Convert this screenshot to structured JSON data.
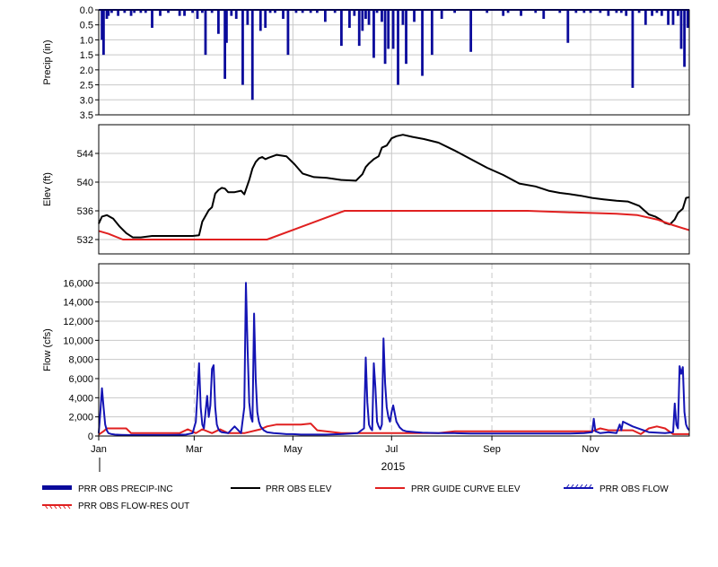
{
  "colors": {
    "precip": "#0a0a9b",
    "obs_elev": "#000000",
    "guide_curve": "#e02020",
    "obs_flow": "#1414b4",
    "res_out": "#e02020",
    "grid": "#c8c8c8",
    "frame": "#000000"
  },
  "chart_data": [
    {
      "type": "bar",
      "ylabel": "Precip (in)",
      "ylim": [
        0,
        3.5
      ],
      "y_inverted": true,
      "yticks": [
        "0.0",
        "0.5",
        "1.0",
        "1.5",
        "2.0",
        "2.5",
        "3.0",
        "3.5"
      ],
      "x_unit": "day of year 2015",
      "series": [
        {
          "name": "PRR OBS PRECIP-INC",
          "x": [
            2,
            3,
            5,
            6,
            8,
            12,
            16,
            20,
            22,
            26,
            29,
            33,
            38,
            43,
            50,
            53,
            58,
            61,
            64,
            66,
            70,
            74,
            78,
            79,
            82,
            85,
            89,
            92,
            95,
            100,
            103,
            106,
            109,
            114,
            117,
            122,
            126,
            131,
            135,
            140,
            146,
            150,
            155,
            158,
            161,
            163,
            165,
            167,
            170,
            172,
            175,
            177,
            179,
            182,
            185,
            188,
            190,
            195,
            200,
            206,
            212,
            220,
            230,
            240,
            250,
            253,
            261,
            270,
            275,
            285,
            290,
            295,
            300,
            304,
            310,
            315,
            320,
            323,
            326,
            330,
            334,
            338,
            342,
            345,
            348,
            352,
            355,
            358,
            360,
            362,
            364
          ],
          "values": [
            1.0,
            1.5,
            0.3,
            0.2,
            0.1,
            0.2,
            0.1,
            0.2,
            0.1,
            0.1,
            0.1,
            0.6,
            0.2,
            0.1,
            0.2,
            0.2,
            0.1,
            0.3,
            0.1,
            1.5,
            0.1,
            0.8,
            2.3,
            1.1,
            0.2,
            0.3,
            2.5,
            0.5,
            3.0,
            0.7,
            0.6,
            0.1,
            0.1,
            0.3,
            1.5,
            0.1,
            0.1,
            0.1,
            0.1,
            0.4,
            0.1,
            1.2,
            0.6,
            0.2,
            1.2,
            0.7,
            0.3,
            0.5,
            1.6,
            0.1,
            0.4,
            1.8,
            1.3,
            1.3,
            2.5,
            0.5,
            1.8,
            0.4,
            2.2,
            1.5,
            0.3,
            0.1,
            1.4,
            0.1,
            0.2,
            0.1,
            0.2,
            0.1,
            0.3,
            0.1,
            1.1,
            0.1,
            0.1,
            0.1,
            0.1,
            0.2,
            0.1,
            0.1,
            0.2,
            2.6,
            0.1,
            0.5,
            0.2,
            0.1,
            0.2,
            0.5,
            0.5,
            0.2,
            1.3,
            1.9,
            0.6
          ]
        }
      ]
    },
    {
      "type": "line",
      "ylabel": "Elev (ft)",
      "ylim": [
        530,
        548
      ],
      "yticks": [
        "532",
        "536",
        "540",
        "544"
      ],
      "x_unit": "day of year 2015",
      "series": [
        {
          "name": "PRR OBS ELEV",
          "x": [
            0,
            2,
            5,
            9,
            13,
            17,
            21,
            26,
            33,
            40,
            46,
            52,
            58,
            62,
            64,
            66,
            68,
            70,
            72,
            74,
            76,
            78,
            80,
            84,
            88,
            90,
            93,
            95,
            97,
            99,
            101,
            103,
            105,
            110,
            116,
            121,
            126,
            133,
            141,
            150,
            159,
            163,
            165,
            167,
            170,
            173,
            175,
            178,
            181,
            184,
            188,
            194,
            201,
            210,
            220,
            230,
            240,
            250,
            260,
            270,
            278,
            285,
            292,
            298,
            305,
            312,
            320,
            327,
            334,
            340,
            344,
            347,
            350,
            353,
            356,
            358,
            361,
            363,
            365
          ],
          "values": [
            534.2,
            535.2,
            535.4,
            534.9,
            533.8,
            532.9,
            532.3,
            532.3,
            532.5,
            532.5,
            532.5,
            532.5,
            532.5,
            532.6,
            534.5,
            535.3,
            536.1,
            536.5,
            538.4,
            538.9,
            539.2,
            539.1,
            538.6,
            538.6,
            538.8,
            538.3,
            540.3,
            541.9,
            542.8,
            543.3,
            543.5,
            543.2,
            543.4,
            543.8,
            543.6,
            542.5,
            541.2,
            540.7,
            540.6,
            540.3,
            540.2,
            541.1,
            542.1,
            542.6,
            543.2,
            543.6,
            544.8,
            545.1,
            546.1,
            546.4,
            546.6,
            546.3,
            546.0,
            545.5,
            544.4,
            543.2,
            542.0,
            541.0,
            539.8,
            539.4,
            538.8,
            538.5,
            538.3,
            538.1,
            537.8,
            537.6,
            537.4,
            537.3,
            536.7,
            535.5,
            535.2,
            534.8,
            534.3,
            534.1,
            534.8,
            535.7,
            536.3,
            537.8,
            537.9
          ]
        },
        {
          "name": "PRR GUIDE CURVE ELEV",
          "x": [
            0,
            6,
            15,
            104,
            152,
            181,
            249,
            265,
            290,
            320,
            333,
            345,
            355,
            365
          ],
          "values": [
            533.2,
            532.8,
            532.0,
            532.0,
            536.0,
            536.0,
            536.0,
            536.0,
            535.8,
            535.6,
            535.4,
            534.8,
            534.0,
            533.3
          ]
        }
      ]
    },
    {
      "type": "line",
      "ylabel": "Flow (cfs)",
      "ylim": [
        0,
        18000
      ],
      "yticks": [
        "0",
        "2,000",
        "4,000",
        "6,000",
        "8,000",
        "10,000",
        "12,000",
        "14,000",
        "16,000"
      ],
      "x_unit": "day of year 2015",
      "x_tick_labels": [
        "Jan",
        "Mar",
        "May",
        "Jul",
        "Sep",
        "Nov"
      ],
      "x_tick_days": [
        0,
        59,
        120,
        181,
        243,
        304
      ],
      "year_label": "2015",
      "series": [
        {
          "name": "PRR OBS FLOW",
          "x": [
            0,
            1,
            2,
            3,
            4,
            5,
            6,
            8,
            10,
            14,
            18,
            24,
            30,
            36,
            42,
            48,
            54,
            58,
            60,
            61,
            62,
            63,
            64,
            65,
            66,
            67,
            68,
            69,
            70,
            71,
            72,
            73,
            74,
            75,
            76,
            80,
            84,
            88,
            90,
            91,
            92,
            93,
            94,
            95,
            96,
            97,
            98,
            99,
            100,
            102,
            104,
            108,
            112,
            116,
            120,
            125,
            130,
            140,
            150,
            160,
            164,
            165,
            166,
            167,
            168,
            169,
            170,
            171,
            172,
            173,
            174,
            175,
            176,
            177,
            178,
            179,
            180,
            181,
            182,
            184,
            186,
            188,
            190,
            196,
            200,
            210,
            220,
            230,
            240,
            250,
            260,
            270,
            280,
            290,
            300,
            305,
            306,
            307,
            310,
            315,
            320,
            322,
            323,
            324,
            330,
            340,
            350,
            355,
            356,
            357,
            358,
            359,
            360,
            361,
            362,
            363,
            364,
            365
          ],
          "values": [
            300,
            2500,
            5000,
            3000,
            1200,
            600,
            300,
            200,
            150,
            120,
            100,
            100,
            100,
            100,
            100,
            120,
            150,
            300,
            1500,
            4500,
            7600,
            3000,
            1200,
            800,
            2500,
            4200,
            2000,
            3200,
            7000,
            7400,
            3000,
            1200,
            700,
            500,
            400,
            300,
            1000,
            300,
            3000,
            16000,
            9000,
            3500,
            2000,
            1500,
            12800,
            6000,
            2500,
            1500,
            1000,
            600,
            400,
            300,
            250,
            200,
            200,
            150,
            150,
            150,
            200,
            300,
            800,
            8200,
            3500,
            1200,
            800,
            600,
            7600,
            5000,
            1500,
            1000,
            700,
            1200,
            10200,
            5500,
            3000,
            2000,
            1500,
            2500,
            3200,
            1500,
            900,
            600,
            500,
            400,
            350,
            300,
            300,
            250,
            250,
            250,
            250,
            250,
            250,
            250,
            300,
            400,
            1800,
            500,
            300,
            400,
            300,
            1200,
            600,
            1500,
            1000,
            400,
            300,
            400,
            3400,
            1200,
            800,
            7300,
            6500,
            7200,
            2500,
            1200,
            800,
            600
          ]
        },
        {
          "name": "PRR OBS FLOW-RES OUT",
          "x": [
            0,
            3,
            5,
            10,
            17,
            20,
            35,
            50,
            55,
            60,
            64,
            70,
            75,
            80,
            90,
            100,
            104,
            110,
            120,
            125,
            131,
            135,
            150,
            160,
            170,
            180,
            185,
            190,
            200,
            210,
            220,
            230,
            240,
            250,
            260,
            270,
            280,
            290,
            300,
            305,
            310,
            315,
            330,
            335,
            340,
            345,
            350,
            355,
            360,
            365
          ],
          "values": [
            150,
            500,
            800,
            800,
            800,
            300,
            300,
            300,
            700,
            300,
            700,
            300,
            700,
            300,
            300,
            700,
            1000,
            1200,
            1200,
            1200,
            1300,
            600,
            300,
            300,
            300,
            300,
            300,
            300,
            300,
            300,
            500,
            500,
            500,
            500,
            500,
            500,
            500,
            500,
            500,
            500,
            800,
            600,
            600,
            200,
            800,
            1000,
            800,
            200,
            200,
            200
          ]
        }
      ]
    }
  ],
  "legend": [
    {
      "label": "PRR OBS PRECIP-INC",
      "style": "thick-bar"
    },
    {
      "label": "PRR OBS ELEV",
      "style": "line-black"
    },
    {
      "label": "PRR GUIDE CURVE ELEV",
      "style": "line-red"
    },
    {
      "label": "PRR OBS FLOW",
      "style": "hatched-blue"
    },
    {
      "label": "PRR OBS FLOW-RES OUT",
      "style": "hatched-red"
    }
  ]
}
